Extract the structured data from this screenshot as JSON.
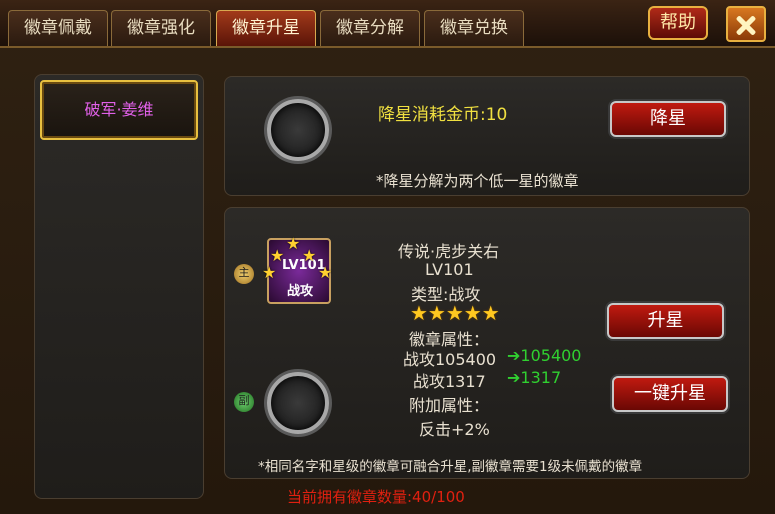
{
  "tabs": [
    "徽章佩戴",
    "徽章强化",
    "徽章升星",
    "徽章分解",
    "徽章兑换"
  ],
  "active_tab_index": 2,
  "help_label": "帮助",
  "hero_list": [
    "破军·姜维"
  ],
  "downgrade": {
    "cost_text": "降星消耗金币:10",
    "button_label": "降星",
    "note": "*降星分解为两个低一星的徽章"
  },
  "badge": {
    "name": "传说·虎步关右",
    "level": "LV101",
    "type": "类型:战攻",
    "star_count": 5,
    "icon_level": "LV101",
    "icon_kind": "战攻",
    "main_tag": "主",
    "sub_tag": "副"
  },
  "attributes": {
    "header": "徽章属性：",
    "rows": [
      {
        "label": "战攻105400",
        "next": "➔105400"
      },
      {
        "label": "战攻1317",
        "next": "➔1317"
      }
    ],
    "extra_header": "附加属性：",
    "extra_value": "反击+2%"
  },
  "upgrade_button": "升星",
  "one_click_button": "一键升星",
  "footer_note": "*相同名字和星级的徽章可融合升星,副徽章需要1级未佩戴的徽章",
  "owned_count": "当前拥有徽章数量:40/100",
  "colors": {
    "accent_red": "#c01a10",
    "gold_border": "#e8c040",
    "hero_name": "#e060e8",
    "yellow_text": "#f0e040",
    "green_text": "#30d030",
    "warning_red": "#e02010"
  }
}
